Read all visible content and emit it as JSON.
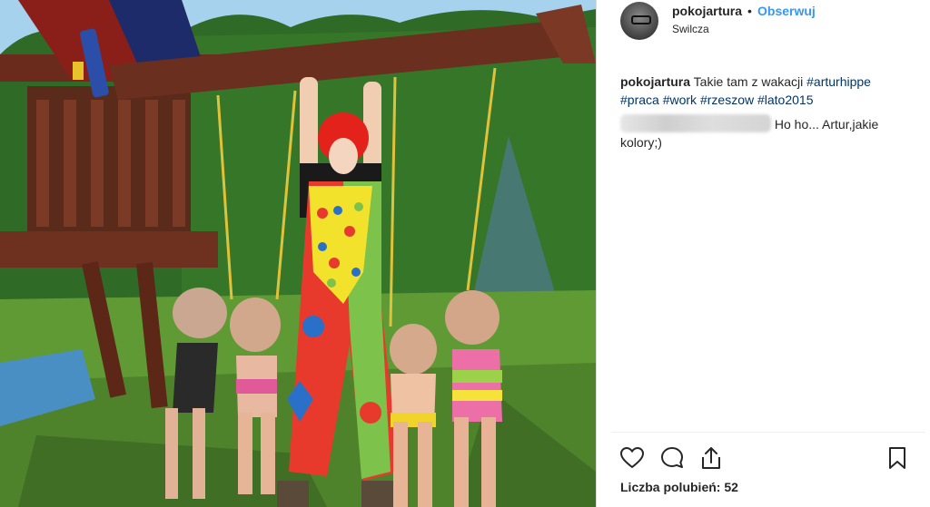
{
  "post": {
    "photo_alt": "",
    "header": {
      "username": "pokojartura",
      "separator": "•",
      "follow_label": "Obserwuj",
      "location": "Swilcza"
    },
    "caption": {
      "author": "pokojartura",
      "text": " Takie tam z wakacji ",
      "tags": [
        "#arturhippe",
        "#praca",
        "#work",
        "#rzeszow",
        "#lato2015"
      ]
    },
    "comments": [
      {
        "author_hidden": true,
        "text": "Ho ho... Artur,jakie kolory;)"
      }
    ],
    "actions": {
      "like_icon": "heart-icon",
      "comment_icon": "comment-icon",
      "share_icon": "share-icon",
      "save_icon": "bookmark-icon"
    },
    "likes": {
      "label": "Liczba polubień:",
      "count": "52"
    },
    "colors": {
      "link_blue": "#3897f0",
      "hashtag": "#003569",
      "text": "#262626",
      "border": "#dbdbdb"
    }
  }
}
